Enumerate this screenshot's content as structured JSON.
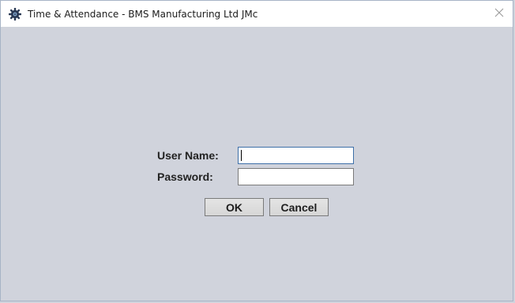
{
  "window": {
    "title": "Time & Attendance - BMS Manufacturing Ltd JMc",
    "app_icon": "gear-logo-icon",
    "close_icon": "close-icon"
  },
  "login": {
    "username_label": "User Name:",
    "username_value": "",
    "password_label": "Password:",
    "password_value": "",
    "ok_label": "OK",
    "cancel_label": "Cancel"
  },
  "colors": {
    "background": "#d0d3dc",
    "titlebar": "#ffffff",
    "focus_border": "#3d6fa8"
  }
}
